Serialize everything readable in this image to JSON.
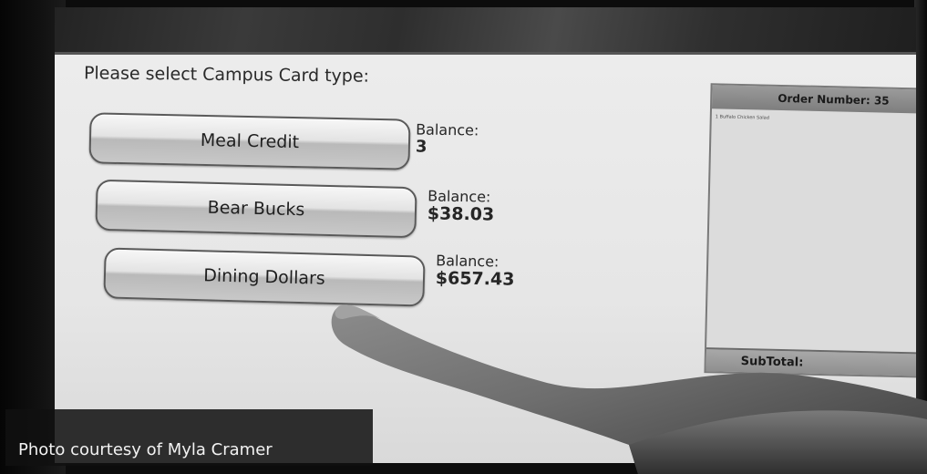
{
  "prompt": "Please select Campus Card type:",
  "card_types": [
    {
      "label": "Meal Credit",
      "balance_label": "Balance:",
      "balance_value": "3"
    },
    {
      "label": "Bear Bucks",
      "balance_label": "Balance:",
      "balance_value": "$38.03"
    },
    {
      "label": "Dining Dollars",
      "balance_label": "Balance:",
      "balance_value": "$657.43"
    }
  ],
  "order_panel": {
    "header": "Order Number: 35",
    "items": [
      "1 Buffalo Chicken Salad"
    ],
    "subtotal_label": "SubTotal:"
  },
  "caption": "Photo courtesy of Myla Cramer"
}
